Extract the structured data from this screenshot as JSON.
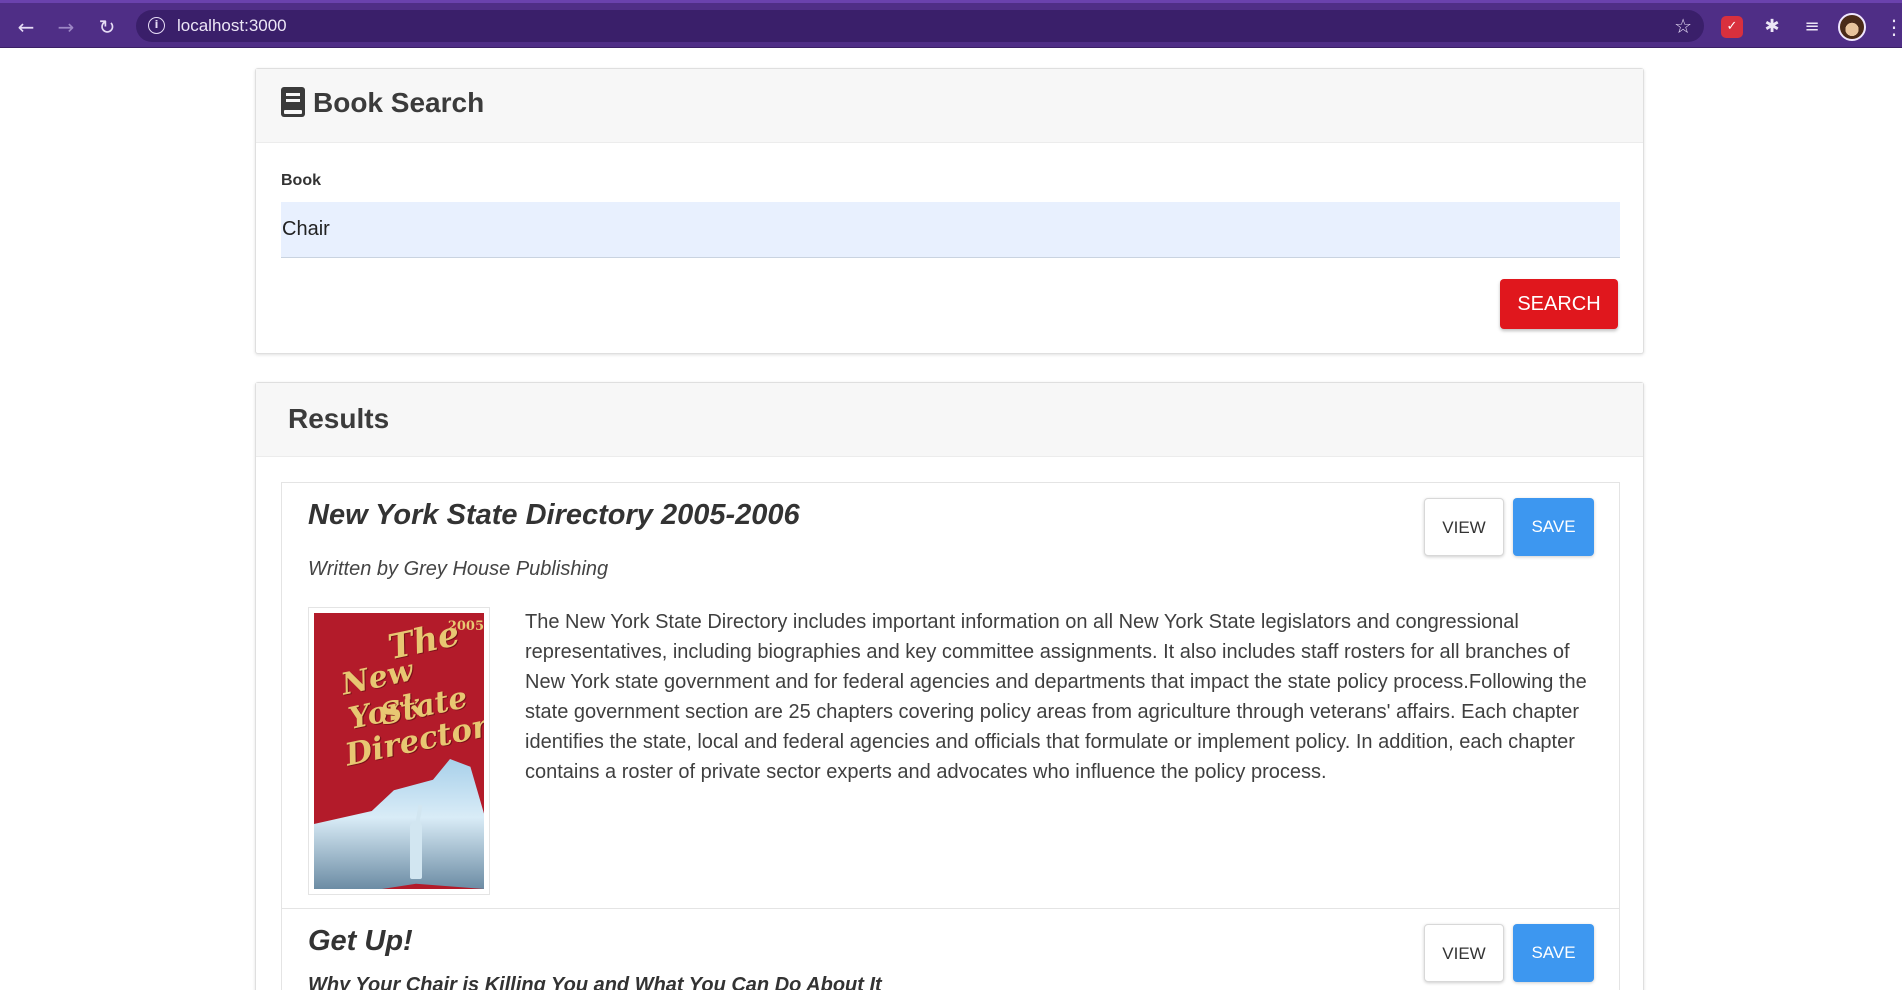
{
  "browser": {
    "url": "localhost:3000",
    "back_icon": "←",
    "forward_icon": "→",
    "reload_icon": "↻",
    "info_icon": "i",
    "bookmark_icon": "☆",
    "pocket_icon": "✓",
    "extensions_icon": "✱",
    "media_icon": "≡",
    "menu_icon": "⋮"
  },
  "search": {
    "title": "Book Search",
    "field_label": "Book",
    "query_value": "Chair",
    "button_label": "SEARCH"
  },
  "results": {
    "title": "Results",
    "items": [
      {
        "title": "New York State Directory 2005-2006",
        "author_line": "Written by Grey House Publishing",
        "view_label": "VIEW",
        "save_label": "SAVE",
        "cover": {
          "year": "2005",
          "line1": "The",
          "line2": "New York",
          "line3": "State",
          "line4": "Directory"
        },
        "description": "The New York State Directory includes important information on all New York State legislators and congressional representatives, including biographies and key committee assignments. It also includes staff rosters for all branches of New York state government and for federal agencies and departments that impact the state policy process.Following the state government section are 25 chapters covering policy areas from agriculture through veterans' affairs. Each chapter identifies the state, local and federal agencies and officials that formulate or implement policy. In addition, each chapter contains a roster of private sector experts and advocates who influence the policy process."
      },
      {
        "title": "Get Up!",
        "subtitle": "Why Your Chair is Killing You and What You Can Do About It",
        "view_label": "VIEW",
        "save_label": "SAVE"
      }
    ]
  },
  "colors": {
    "chrome": "#4f2e86",
    "search_button": "#e0171d",
    "save_button": "#3d97f0",
    "input_background": "#e8f0fe"
  }
}
